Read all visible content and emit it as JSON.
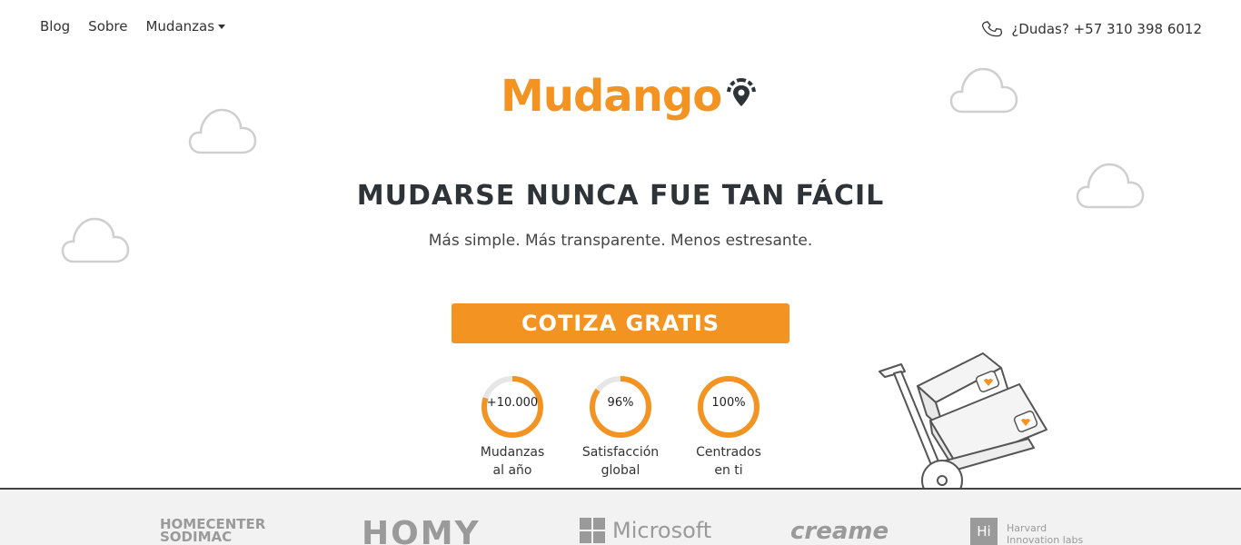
{
  "nav": {
    "blog": "Blog",
    "sobre": "Sobre",
    "mudanzas": "Mudanzas"
  },
  "contact": {
    "phone_text": "¿Dudas? +57 310 398 6012"
  },
  "logo": {
    "text": "Mudango"
  },
  "hero": {
    "headline": "MUDARSE NUNCA FUE TAN FÁCIL",
    "subheadline": "Más simple. Más transparente. Menos estresante.",
    "cta_label": "COTIZA GRATIS"
  },
  "stats": [
    {
      "value": "+10.000",
      "label_line1": "Mudanzas",
      "label_line2": "al año",
      "progress": 0.8
    },
    {
      "value": "96%",
      "label_line1": "Satisfacción",
      "label_line2": "global",
      "progress": 0.85
    },
    {
      "value": "100%",
      "label_line1": "Centrados",
      "label_line2": "en ti",
      "progress": 1.0
    }
  ],
  "partners": {
    "homecenter_line1": "HOMECENTER",
    "homecenter_line2": "SODIMAC",
    "homy": "HOMY",
    "microsoft": "Microsoft",
    "creame": "creame",
    "harvard_badge": "Hi",
    "harvard_line1": "Harvard",
    "harvard_line2": "Innovation labs"
  },
  "colors": {
    "brand_orange": "#f39422",
    "ring_track": "#e6e6e6",
    "text_dark": "#2e3338"
  },
  "icons": {
    "phone": "phone-icon",
    "location_pin": "location-pin-icon",
    "cloud": "cloud-icon",
    "hand_truck": "hand-truck-illustration"
  }
}
